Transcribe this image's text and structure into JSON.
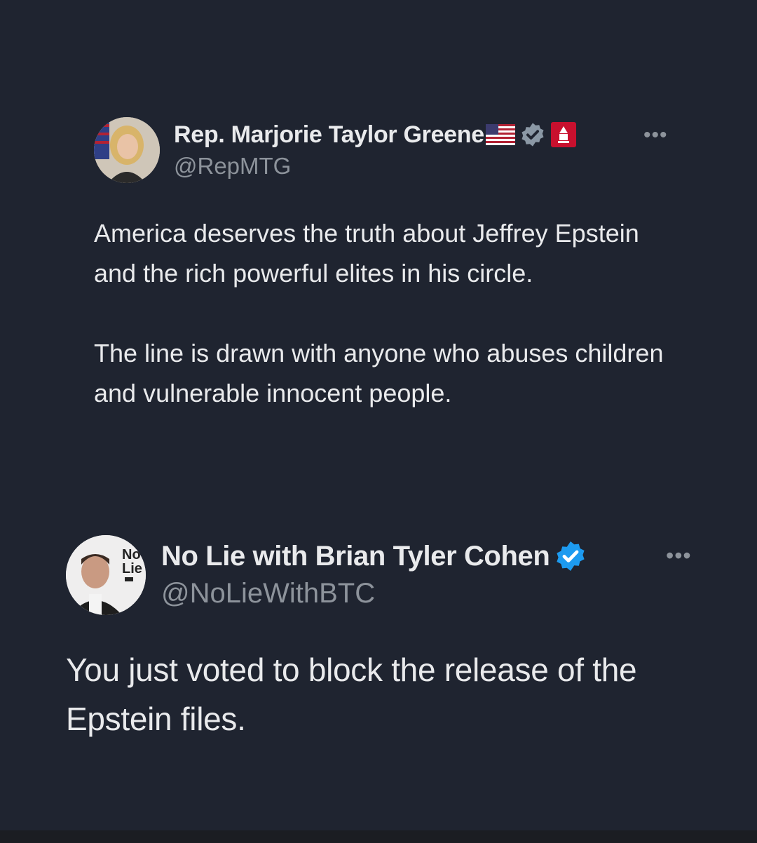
{
  "tweets": [
    {
      "display_name": "Rep. Marjorie Taylor Greene",
      "handle": "@RepMTG",
      "more_label": "•••",
      "verified_badge_color": "#8b98a5",
      "affiliation_badge_color": "#c8102e",
      "icons": [
        "us-flag-icon",
        "verified-badge-icon",
        "house-affiliation-icon",
        "more-options-icon"
      ],
      "paragraphs": [
        "America deserves the truth about Jeffrey Epstein and the rich powerful elites in his circle.",
        "The line is drawn with anyone who abuses children and vulnerable innocent people."
      ]
    },
    {
      "display_name": "No Lie with Brian Tyler Cohen",
      "handle": "@NoLieWithBTC",
      "more_label": "•••",
      "verified_badge_color": "#1d9bf0",
      "avatar_logo_text": [
        "No",
        "Lie"
      ],
      "icons": [
        "verified-badge-icon",
        "more-options-icon"
      ],
      "paragraphs": [
        "You just voted to block the release of the Epstein files."
      ]
    }
  ],
  "colors": {
    "background": "#1f2430",
    "text_primary": "#e9eaec",
    "text_secondary": "#8d939b"
  }
}
